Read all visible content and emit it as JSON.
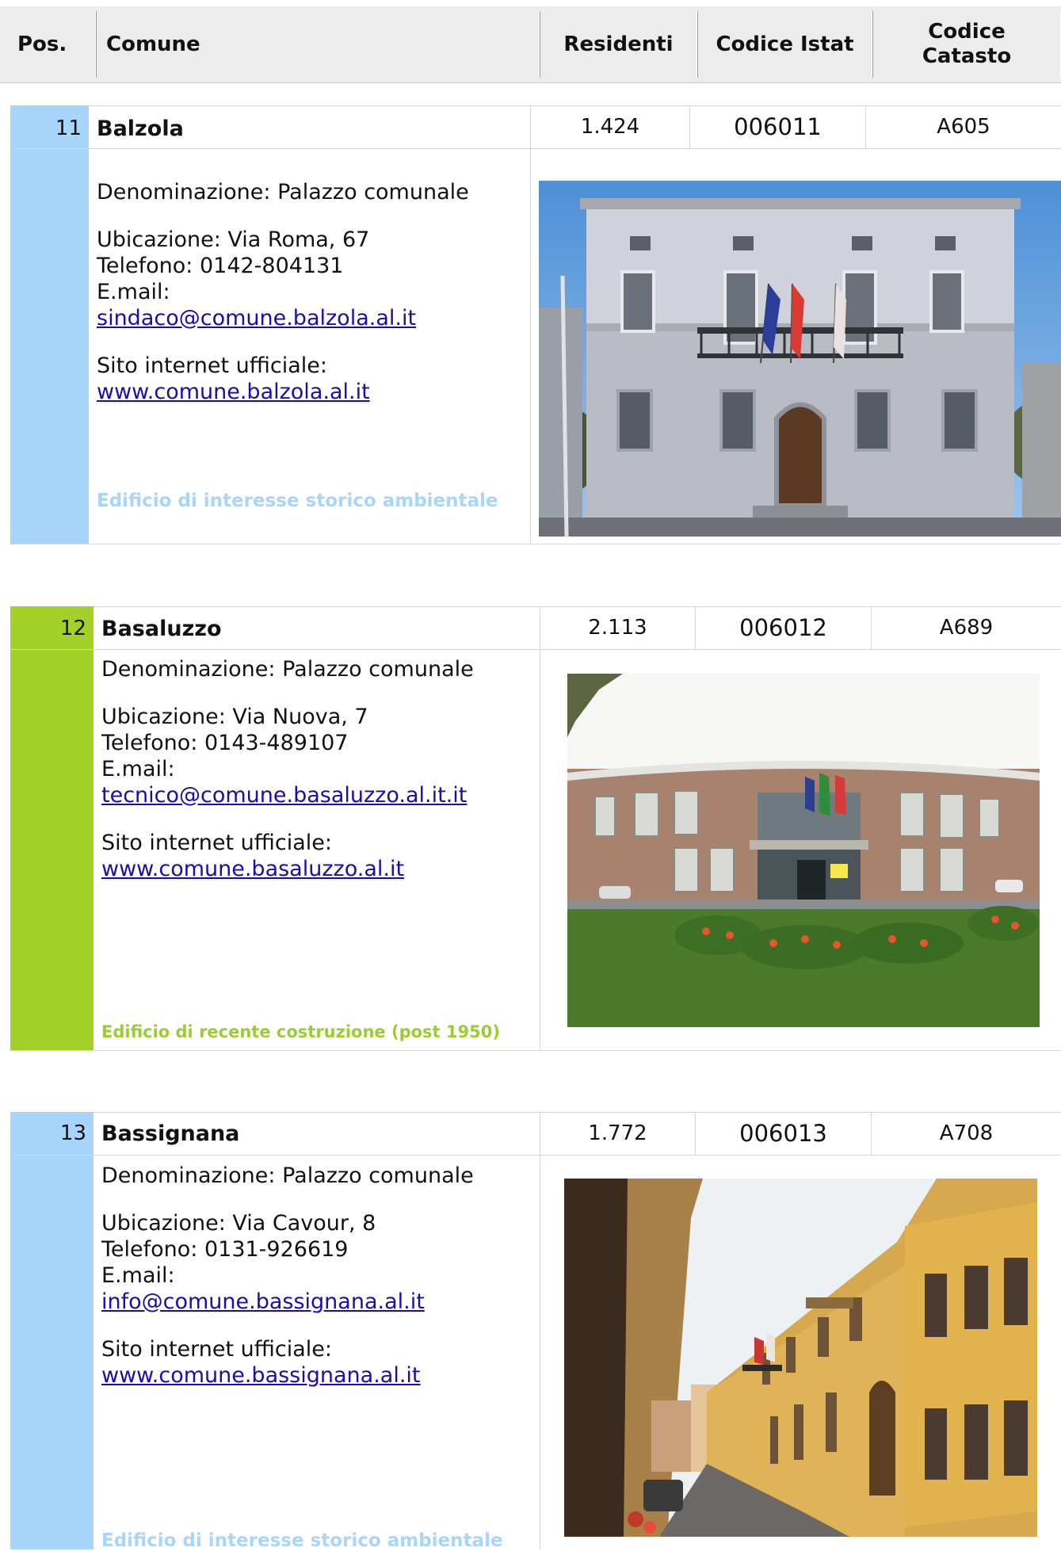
{
  "header": {
    "pos": "Pos.",
    "comune": "Comune",
    "residenti": "Residenti",
    "istat": "Codice Istat",
    "catasto_line1": "Codice",
    "catasto_line2": "Catasto"
  },
  "colors": {
    "historic_strip": "#a8d5fb",
    "recent_strip": "#a3d129",
    "historic_note": "#a8d5fb",
    "recent_note": "#9acd32"
  },
  "records": [
    {
      "pos": "11",
      "name": "Balzola",
      "residents": "1.424",
      "istat": "006011",
      "catasto": "A605",
      "denominazione": "Denominazione: Palazzo comunale",
      "ubicazione": "Ubicazione: Via Roma, 67",
      "telefono": "Telefono: 0142-804131",
      "email_label": "E.mail:",
      "email": "sindaco@comune.balzola.al.it",
      "sito_label": "Sito internet ufficiale:",
      "sito": "www.comune.balzola.al.it",
      "note": "Edificio di interesse storico ambientale",
      "photo_subject": "palazzo-comunale-balzola-photo"
    },
    {
      "pos": "12",
      "name": "Basaluzzo",
      "residents": "2.113",
      "istat": "006012",
      "catasto": "A689",
      "denominazione": "Denominazione: Palazzo comunale",
      "ubicazione": "Ubicazione: Via Nuova, 7",
      "telefono": "Telefono: 0143-489107",
      "email_label": "E.mail:",
      "email": "tecnico@comune.basaluzzo.al.it.it",
      "sito_label": "Sito internet ufficiale:",
      "sito": "www.comune.basaluzzo.al.it",
      "note": "Edificio di recente costruzione (post 1950)",
      "photo_subject": "palazzo-comunale-basaluzzo-photo"
    },
    {
      "pos": "13",
      "name": "Bassignana",
      "residents": "1.772",
      "istat": "006013",
      "catasto": "A708",
      "denominazione": "Denominazione: Palazzo comunale",
      "ubicazione": "Ubicazione: Via Cavour, 8",
      "telefono": "Telefono: 0131-926619",
      "email_label": "E.mail:",
      "email": "info@comune.bassignana.al.it",
      "sito_label": "Sito internet ufficiale:",
      "sito": "www.comune.bassignana.al.it",
      "note": "Edificio di interesse storico ambientale",
      "photo_subject": "palazzo-comunale-bassignana-photo"
    }
  ]
}
